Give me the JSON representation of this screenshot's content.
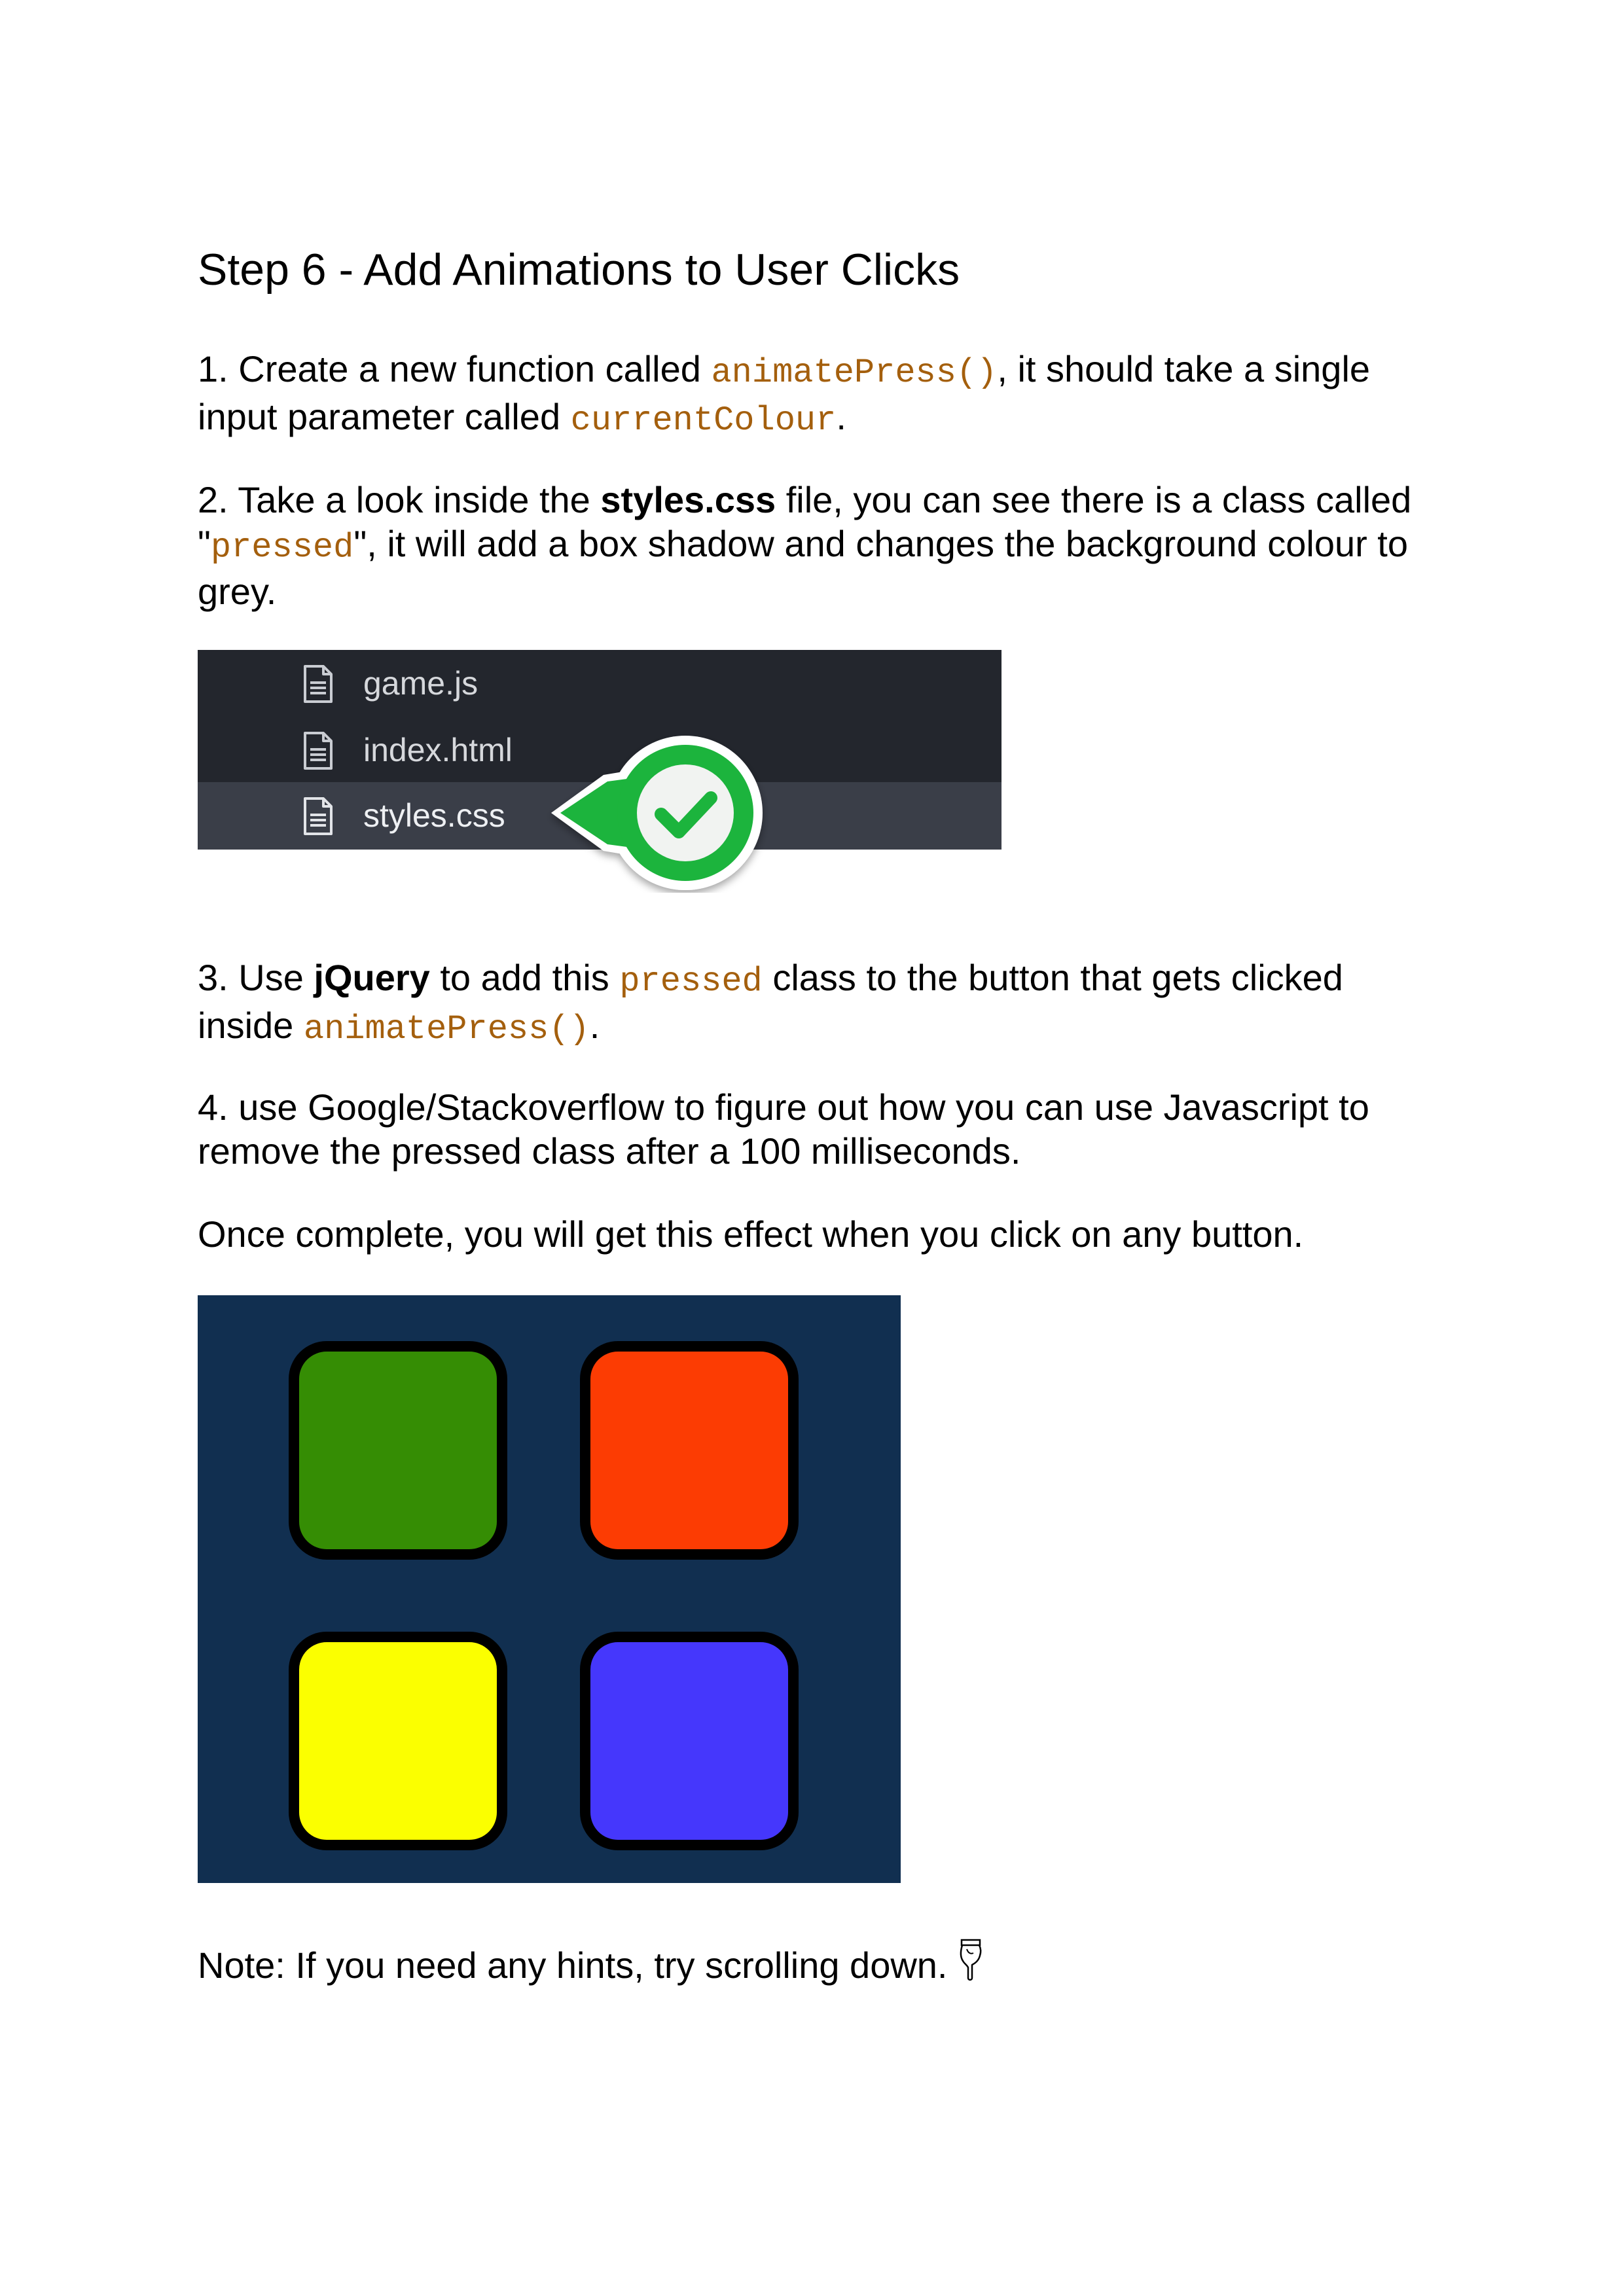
{
  "title": "Step 6 - Add Animations to User Clicks",
  "step1": {
    "text_a": "1. Create a new function called ",
    "code_a": "animatePress()",
    "text_b": ", it should take a single",
    "text_c": "input parameter called ",
    "code_b": "currentColour",
    "text_d": "."
  },
  "step2": {
    "text_a": "2. Take a look inside the ",
    "bold_a": "styles.css",
    "text_b": " file, you can see there is a class called",
    "quote_open": "\"",
    "code_a": "pressed",
    "text_c": "\", it will add a box shadow and changes the background colour to",
    "text_d": "grey."
  },
  "file_tree": {
    "files": [
      "game.js",
      "index.html",
      "styles.css"
    ],
    "selected": "styles.css",
    "icon": "file-icon",
    "badge_icon": "checkmark-icon"
  },
  "step3": {
    "text_a": "3. Use ",
    "bold_a": "jQuery",
    "text_b": " to add this ",
    "code_a": "pressed",
    "text_c": " class to the button that gets clicked",
    "text_d": "inside ",
    "code_b": "animatePress()",
    "text_e": "."
  },
  "step4": {
    "line1": "4. use Google/Stackoverflow to figure out how you can use Javascript to",
    "line2": "remove the pressed class after a 100 milliseconds."
  },
  "once_complete": "Once complete, you will get this effect when you click on any button.",
  "board": {
    "background": "#112f50",
    "buttons": [
      {
        "name": "green",
        "color": "#358d04"
      },
      {
        "name": "red",
        "color": "#fc3c03"
      },
      {
        "name": "yellow",
        "color": "#fbff00"
      },
      {
        "name": "blue",
        "color": "#4537fc"
      }
    ]
  },
  "note": "Note: If you need any hints, try scrolling down.",
  "note_icon": "pointing-down-hand-icon",
  "colors": {
    "code": "#a45f0d",
    "tree_bg": "#23262d",
    "tree_selected": "#3a3e48",
    "badge_green": "#1cb43c"
  }
}
